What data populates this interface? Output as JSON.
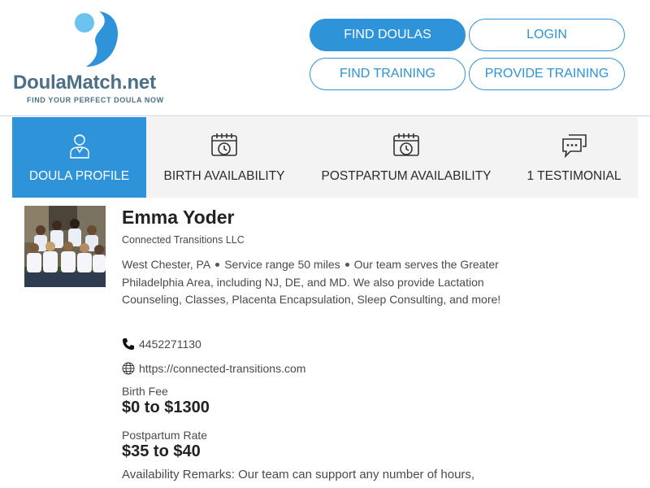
{
  "brand": {
    "name": "DoulaMatch.net",
    "tagline": "FIND YOUR PERFECT DOULA NOW",
    "colors": {
      "primary": "#2e93d8",
      "light": "#6cc3f0",
      "text": "#4a6f86"
    }
  },
  "nav": {
    "find_doulas": "FIND DOULAS",
    "login": "LOGIN",
    "find_training": "FIND TRAINING",
    "provide_training": "PROVIDE TRAINING"
  },
  "tabs": [
    {
      "label": "DOULA PROFILE",
      "icon": "doula-person-icon",
      "active": true
    },
    {
      "label": "BIRTH AVAILABILITY",
      "icon": "calendar-clock-icon",
      "active": false
    },
    {
      "label": "POSTPARTUM AVAILABILITY",
      "icon": "calendar-clock-icon",
      "active": false
    },
    {
      "label": "1 TESTIMONIAL",
      "icon": "chat-bubble-icon",
      "active": false
    }
  ],
  "profile": {
    "name": "Emma Yoder",
    "company": "Connected Transitions LLC",
    "location": "West Chester, PA",
    "service_range": "Service range 50 miles",
    "description": "Our team serves the Greater Philadelphia Area, including NJ, DE, and MD. We also provide Lactation Counseling, Classes, Placenta Encapsulation, Sleep Consulting, and more!",
    "phone": "4452271130",
    "website": "https://connected-transitions.com",
    "birth_fee_label": "Birth Fee",
    "birth_fee": "$0 to $1300",
    "postpartum_rate_label": "Postpartum Rate",
    "postpartum_rate": "$35 to $40",
    "availability_remarks": "Availability Remarks: Our team can support any number of hours,"
  }
}
